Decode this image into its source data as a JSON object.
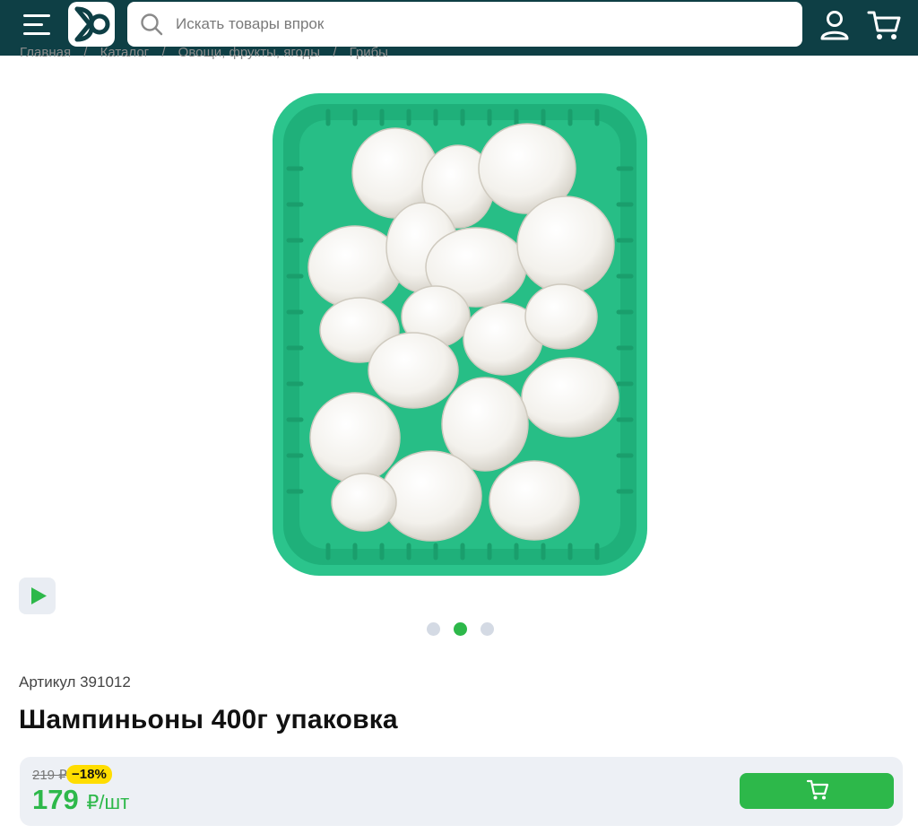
{
  "header": {
    "search": {
      "placeholder": "Искать товары впрок",
      "value": ""
    },
    "colors": {
      "bar": "#0e3f45",
      "accent": "#2db84a"
    },
    "icons": [
      "menu-icon",
      "logo-icon",
      "search-icon",
      "user-icon",
      "cart-icon"
    ]
  },
  "breadcrumb": [
    "Главная",
    "/",
    "Каталог",
    "/",
    "Овощи, фрукты, ягоды",
    "/",
    "Грибы"
  ],
  "gallery": {
    "total_slides": 3,
    "active_slide": 2
  },
  "product": {
    "article_label": "Артикул 391012",
    "title": "Шампиньоны 400г упаковка"
  },
  "price": {
    "old": "219 ₽",
    "discount": "−18%",
    "current": "179",
    "unit": "₽/шт"
  }
}
